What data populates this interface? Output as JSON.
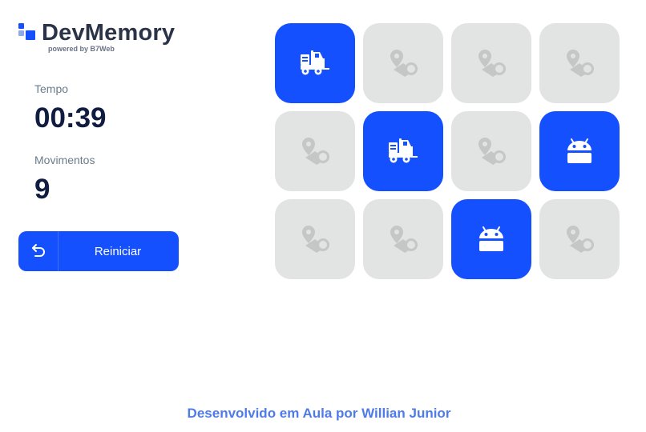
{
  "logo": {
    "name": "DevMemory",
    "subtitle": "powered by B7Web"
  },
  "stats": {
    "time_label": "Tempo",
    "time_value": "00:39",
    "moves_label": "Movimentos",
    "moves_value": "9"
  },
  "restart": {
    "label": "Reiniciar",
    "icon": "undo-icon"
  },
  "colors": {
    "accent": "#1550FF",
    "card_hidden": "#E2E3E3",
    "text_dark": "#101C40",
    "footer_text": "#4E7BEA"
  },
  "grid": {
    "columns": 4,
    "cards": [
      {
        "state": "shown",
        "icon": "fork-truck-icon"
      },
      {
        "state": "hidden",
        "icon": "map-pin-icon"
      },
      {
        "state": "hidden",
        "icon": "map-pin-icon"
      },
      {
        "state": "hidden",
        "icon": "map-pin-icon"
      },
      {
        "state": "hidden",
        "icon": "map-pin-icon"
      },
      {
        "state": "shown",
        "icon": "fork-truck-icon"
      },
      {
        "state": "hidden",
        "icon": "map-pin-icon"
      },
      {
        "state": "shown",
        "icon": "android-icon"
      },
      {
        "state": "hidden",
        "icon": "map-pin-icon"
      },
      {
        "state": "hidden",
        "icon": "map-pin-icon"
      },
      {
        "state": "shown",
        "icon": "android-icon"
      },
      {
        "state": "hidden",
        "icon": "map-pin-icon"
      }
    ]
  },
  "footer": {
    "text": "Desenvolvido em Aula por Willian Junior"
  }
}
